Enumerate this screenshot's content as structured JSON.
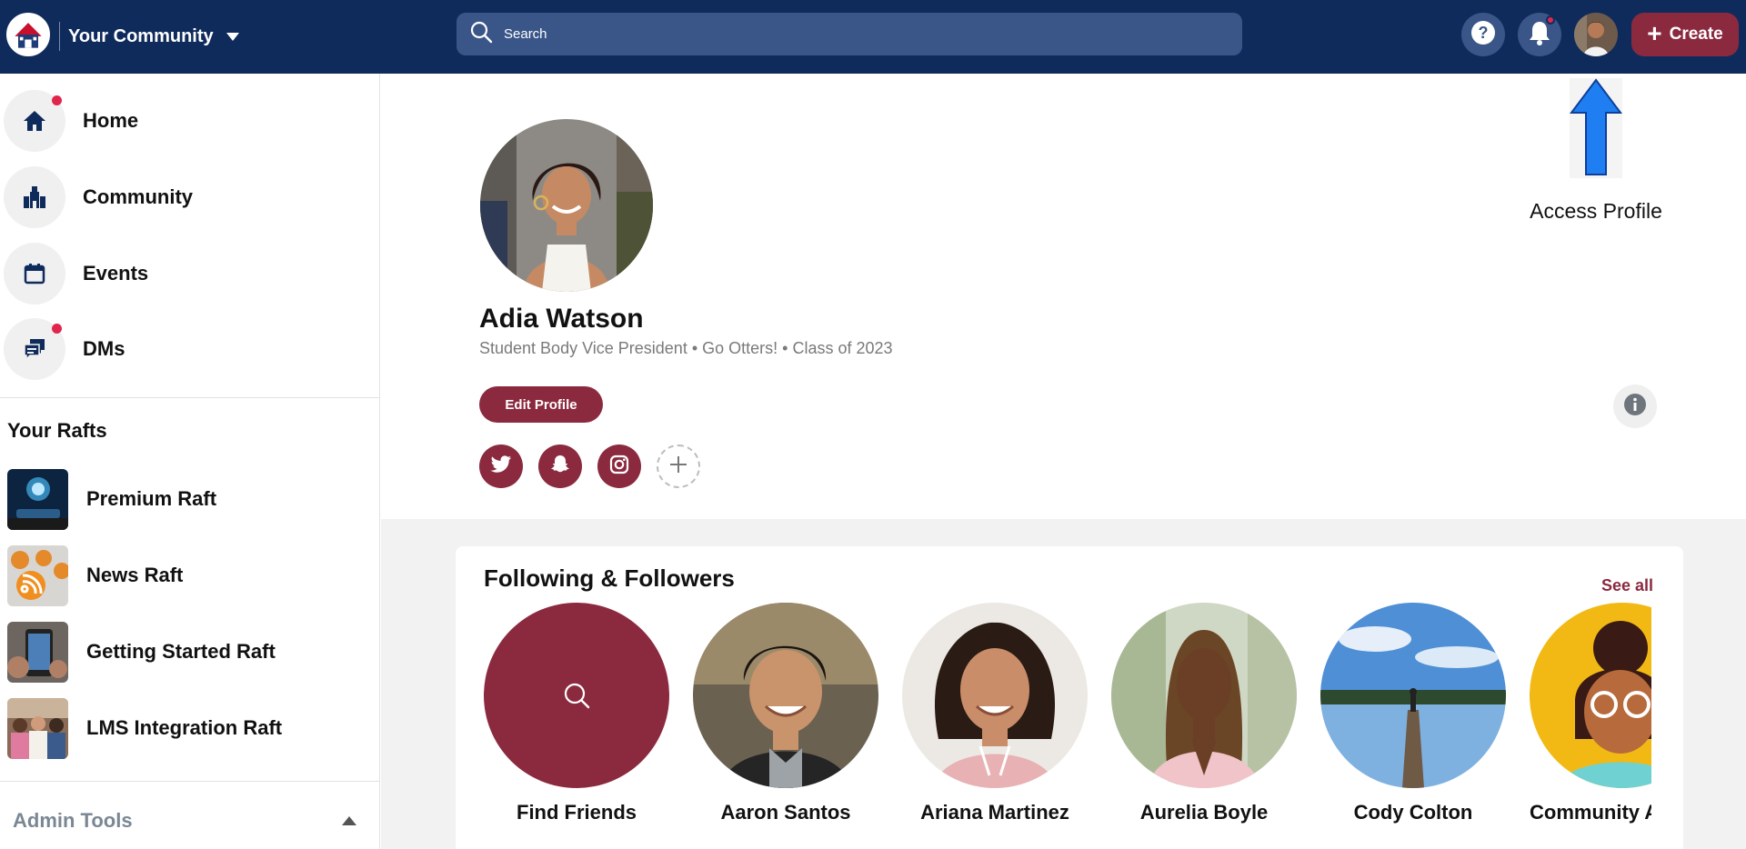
{
  "header": {
    "community_name": "Your Community",
    "search_placeholder": "Search",
    "create_label": "Create",
    "help_icon": "question-circle-icon",
    "notifications_icon": "bell-icon",
    "notifications_unread": true
  },
  "sidebar": {
    "nav": [
      {
        "label": "Home",
        "icon": "home-icon",
        "unread": true
      },
      {
        "label": "Community",
        "icon": "community-icon",
        "unread": false
      },
      {
        "label": "Events",
        "icon": "calendar-icon",
        "unread": false
      },
      {
        "label": "DMs",
        "icon": "chat-icon",
        "unread": true
      }
    ],
    "rafts_heading": "Your Rafts",
    "rafts": [
      {
        "label": "Premium Raft"
      },
      {
        "label": "News Raft"
      },
      {
        "label": "Getting Started Raft"
      },
      {
        "label": "LMS Integration Raft"
      }
    ],
    "admin_tools_label": "Admin Tools"
  },
  "profile": {
    "name": "Adia Watson",
    "bio": "Student Body Vice President • Go Otters! • Class of 2023",
    "edit_label": "Edit Profile",
    "socials": [
      "twitter-icon",
      "snapchat-icon",
      "instagram-icon",
      "add-icon"
    ]
  },
  "annotation": {
    "label": "Access Profile"
  },
  "following": {
    "title": "Following & Followers",
    "see_all_label": "See all",
    "people": [
      {
        "name": "Find Friends"
      },
      {
        "name": "Aaron Santos"
      },
      {
        "name": "Ariana Martinez"
      },
      {
        "name": "Aurelia Boyle"
      },
      {
        "name": "Cody Colton"
      },
      {
        "name": "Community A"
      }
    ]
  },
  "colors": {
    "navy": "#0f2b5c",
    "accent": "#8b2a3f",
    "alert": "#e0264d"
  }
}
